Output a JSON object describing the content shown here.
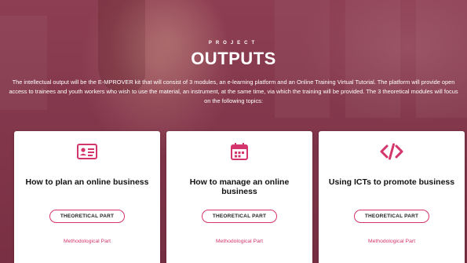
{
  "hero": {
    "eyebrow": "PROJECT",
    "title": "OUTPUTS",
    "intro": "The intellectual output will be the E-MPROVER kit that will consist of 3 modules, an e-learning platform and an Online Training Virtual Tutorial. The platform will provide open access to trainees and youth workers who wish to use the material, an instrument, at the same time, via which the training will be provided. The 3 theoretical modules will focus on the following topics:"
  },
  "cards": [
    {
      "icon": "id-card-icon",
      "title": "How to plan an online business",
      "button_label": "THEORETICAL PART",
      "link_label": "Methodological Part"
    },
    {
      "icon": "calendar-icon",
      "title": "How to manage an online business",
      "button_label": "THEORETICAL PART",
      "link_label": "Methodological Part"
    },
    {
      "icon": "code-icon",
      "title": "Using ICTs to promote business",
      "button_label": "THEORETICAL PART",
      "link_label": "Methodological Part"
    }
  ],
  "colors": {
    "accent": "#d5356d",
    "overlay": "#7e3a4c"
  }
}
